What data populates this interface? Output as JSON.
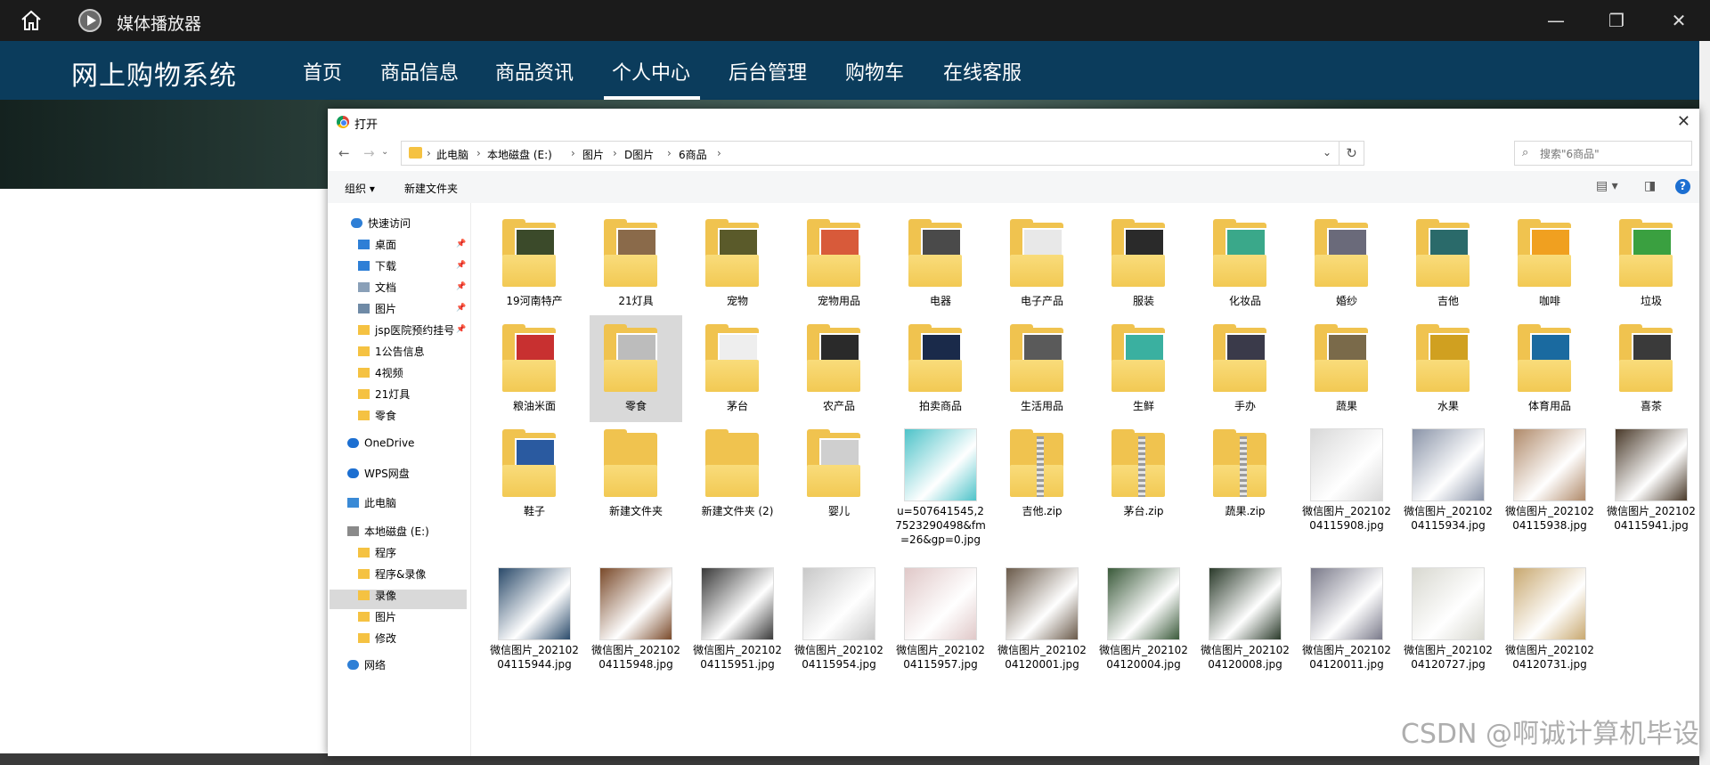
{
  "player": {
    "title": "媒体播放器",
    "icons": [
      "home-icon",
      "player-logo-icon",
      "minimize-icon",
      "restore-icon",
      "close-icon"
    ]
  },
  "site": {
    "brand": "网上购物系统",
    "nav": [
      "首页",
      "商品信息",
      "商品资讯",
      "个人中心",
      "后台管理",
      "购物车",
      "在线客服"
    ],
    "active_nav": "个人中心"
  },
  "dialog": {
    "title": "打开",
    "breadcrumbs": [
      "此电脑",
      "本地磁盘 (E:)",
      "图片",
      "D图片",
      "6商品"
    ],
    "search_placeholder": "搜索\"6商品\"",
    "toolbar": {
      "organize": "组织 ▾",
      "new_folder": "新建文件夹"
    },
    "nav_pane": [
      {
        "label": "快速访问",
        "icon": "star-icon",
        "pinned": false
      },
      {
        "label": "桌面",
        "icon": "desktop-icon",
        "pinned": true
      },
      {
        "label": "下载",
        "icon": "download-icon",
        "pinned": true
      },
      {
        "label": "文档",
        "icon": "document-icon",
        "pinned": true
      },
      {
        "label": "图片",
        "icon": "pictures-icon",
        "pinned": true
      },
      {
        "label": "jsp医院预约挂号",
        "icon": "folder-icon",
        "pinned": true
      },
      {
        "label": "1公告信息",
        "icon": "folder-icon",
        "pinned": false
      },
      {
        "label": "4视频",
        "icon": "folder-icon",
        "pinned": false
      },
      {
        "label": "21灯具",
        "icon": "folder-icon",
        "pinned": false
      },
      {
        "label": "零食",
        "icon": "folder-icon",
        "pinned": false
      },
      {
        "label": "OneDrive",
        "icon": "cloud-icon",
        "pinned": false
      },
      {
        "label": "WPS网盘",
        "icon": "cloud-icon",
        "pinned": false
      },
      {
        "label": "此电脑",
        "icon": "computer-icon",
        "pinned": false,
        "selected": true
      },
      {
        "label": "本地磁盘 (E:)",
        "icon": "drive-icon",
        "pinned": false
      },
      {
        "label": "程序",
        "icon": "folder-icon",
        "pinned": false
      },
      {
        "label": "程序&录像",
        "icon": "folder-icon",
        "pinned": false
      },
      {
        "label": "录像",
        "icon": "folder-icon",
        "pinned": false
      },
      {
        "label": "图片",
        "icon": "folder-icon",
        "pinned": false
      },
      {
        "label": "修改",
        "icon": "folder-icon",
        "pinned": false
      },
      {
        "label": "网络",
        "icon": "network-icon",
        "pinned": false
      }
    ],
    "files": [
      {
        "name": "19河南特产",
        "type": "folder",
        "color": "#3b4a2a"
      },
      {
        "name": "21灯具",
        "type": "folder",
        "color": "#8a6a4a"
      },
      {
        "name": "宠物",
        "type": "folder",
        "color": "#5a5a2a"
      },
      {
        "name": "宠物用品",
        "type": "folder",
        "color": "#d85a3a"
      },
      {
        "name": "电器",
        "type": "folder",
        "color": "#4a4a4a"
      },
      {
        "name": "电子产品",
        "type": "folder",
        "color": "#e8e8e8"
      },
      {
        "name": "服装",
        "type": "folder",
        "color": "#2a2a2a"
      },
      {
        "name": "化妆品",
        "type": "folder",
        "color": "#3aa88a"
      },
      {
        "name": "婚纱",
        "type": "folder",
        "color": "#6a6a7a"
      },
      {
        "name": "吉他",
        "type": "folder",
        "color": "#2a6a6a"
      },
      {
        "name": "咖啡",
        "type": "folder",
        "color": "#f0a020"
      },
      {
        "name": "垃圾",
        "type": "folder",
        "color": "#3aa040"
      },
      {
        "name": "粮油米面",
        "type": "folder",
        "color": "#c83030"
      },
      {
        "name": "零食",
        "type": "folder",
        "color": "#bcbcbc",
        "selected": true
      },
      {
        "name": "茅台",
        "type": "folder",
        "color": "#eeeeee"
      },
      {
        "name": "农产品",
        "type": "folder",
        "color": "#2a2a2a"
      },
      {
        "name": "拍卖商品",
        "type": "folder",
        "color": "#1a2a4a"
      },
      {
        "name": "生活用品",
        "type": "folder",
        "color": "#5a5a5a"
      },
      {
        "name": "生鲜",
        "type": "folder",
        "color": "#3ab0a0"
      },
      {
        "name": "手办",
        "type": "folder",
        "color": "#3a3a4a"
      },
      {
        "name": "蔬果",
        "type": "folder",
        "color": "#7a6a4a"
      },
      {
        "name": "水果",
        "type": "folder",
        "color": "#d0a020"
      },
      {
        "name": "体育用品",
        "type": "folder",
        "color": "#1a6aa0"
      },
      {
        "name": "喜茶",
        "type": "folder",
        "color": "#3a3a3a"
      },
      {
        "name": "鞋子",
        "type": "folder",
        "color": "#2a5aa0"
      },
      {
        "name": "新建文件夹",
        "type": "empty-folder",
        "color": "#f0c34f"
      },
      {
        "name": "新建文件夹 (2)",
        "type": "empty-folder",
        "color": "#f0c34f"
      },
      {
        "name": "婴儿",
        "type": "folder",
        "color": "#cfcfcf"
      },
      {
        "name": "u=507641545,27523290498&fm=26&gp=0.jpg",
        "type": "image",
        "color": "#4ec3c9"
      },
      {
        "name": "吉他.zip",
        "type": "zip",
        "color": "#f0c34f"
      },
      {
        "name": "茅台.zip",
        "type": "zip",
        "color": "#f0c34f"
      },
      {
        "name": "蔬果.zip",
        "type": "zip",
        "color": "#f0c34f"
      },
      {
        "name": "微信图片_20210204115908.jpg",
        "type": "image",
        "color": "#d8d8d8"
      },
      {
        "name": "微信图片_20210204115934.jpg",
        "type": "image",
        "color": "#8a94a8"
      },
      {
        "name": "微信图片_20210204115938.jpg",
        "type": "image",
        "color": "#b08a6a"
      },
      {
        "name": "微信图片_20210204115941.jpg",
        "type": "image",
        "color": "#4a3a2a"
      },
      {
        "name": "微信图片_20210204115944.jpg",
        "type": "image",
        "color": "#2a4a6a"
      },
      {
        "name": "微信图片_20210204115948.jpg",
        "type": "image",
        "color": "#7a4a2a"
      },
      {
        "name": "微信图片_20210204115951.jpg",
        "type": "image",
        "color": "#3a3a3a"
      },
      {
        "name": "微信图片_20210204115954.jpg",
        "type": "image",
        "color": "#c8c8c8"
      },
      {
        "name": "微信图片_20210204115957.jpg",
        "type": "image",
        "color": "#e0c8c8"
      },
      {
        "name": "微信图片_20210204120001.jpg",
        "type": "image",
        "color": "#6a5a4a"
      },
      {
        "name": "微信图片_20210204120004.jpg",
        "type": "image",
        "color": "#3a5a3a"
      },
      {
        "name": "微信图片_20210204120008.jpg",
        "type": "image",
        "color": "#2a3a2a"
      },
      {
        "name": "微信图片_20210204120011.jpg",
        "type": "image",
        "color": "#7a7a8a"
      },
      {
        "name": "微信图片_20210204120727.jpg",
        "type": "image",
        "color": "#d8d8d0"
      },
      {
        "name": "微信图片_20210204120731.jpg",
        "type": "image",
        "color": "#c8a870"
      }
    ]
  },
  "watermark": "CSDN @啊诚计算机毕设"
}
